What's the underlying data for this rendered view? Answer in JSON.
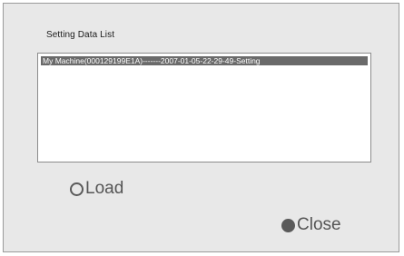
{
  "dialog": {
    "title": "Setting Data List"
  },
  "list": {
    "items": [
      {
        "label": "My Machine(000129199E1A)-------2007-01-05-22-29-49-Setting",
        "selected": true
      }
    ]
  },
  "buttons": {
    "load_label": "Load",
    "load_icon": "radio-unselected-icon",
    "close_label": "Close",
    "close_icon": "radio-selected-icon"
  },
  "colors": {
    "background": "#e8e8e8",
    "selection": "#6a6a6a",
    "button_text": "#555555"
  }
}
